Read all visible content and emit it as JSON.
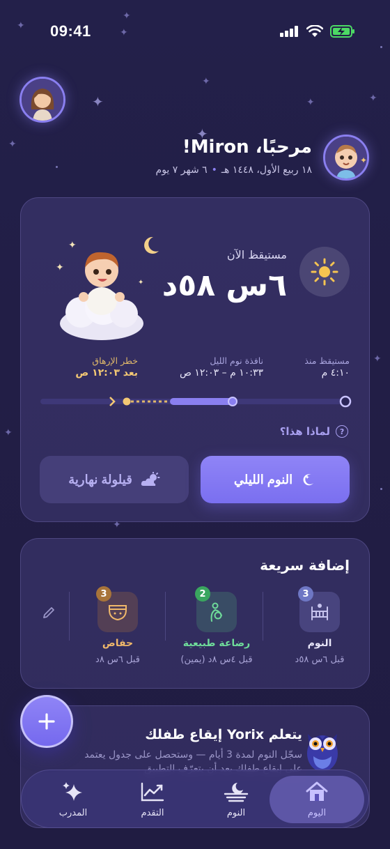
{
  "status_bar": {
    "time": "09:41"
  },
  "greeting": {
    "title": "مرحبًا، Miron!",
    "hijri_date": "١٨ ربيع الأول، ١٤٤٨ هـ",
    "baby_age": "٦ شهر ٧ يوم",
    "separator": "•"
  },
  "status_card": {
    "state_label": "مستيقظ الآن",
    "elapsed": "٦س ٥٨د",
    "awake_since": {
      "label": "مستيقظ منذ",
      "value": "٤:١٠ م"
    },
    "night_window": {
      "label": "نافذة نوم الليل",
      "value": "١٠:٣٣ م – ١٢:٠٣ ص"
    },
    "overtired_risk": {
      "label": "خطر الإرهاق",
      "value": "بعد ١٢:٠٣ ص"
    },
    "why_link": "لماذا هذا؟",
    "why_icon": "?",
    "night_sleep_button": "النوم الليلي",
    "day_nap_button": "قيلولة نهارية",
    "colors": {
      "accent": "#8a7ff0",
      "risk": "#f3c874"
    }
  },
  "quick_add": {
    "title": "إضافة سريعة",
    "items": [
      {
        "name": "النوم",
        "ago": "قبل ٦س ٥٨د",
        "count": "3",
        "icon": "crib-icon",
        "name_color": "#e8e6f8",
        "badge_color": "#6e77c4"
      },
      {
        "name": "رضاعة طبيعية",
        "ago": "قبل ٤س ٨د (يمين)",
        "count": "2",
        "icon": "breastfeeding-icon",
        "name_color": "#6fdc9a",
        "badge_color": "#3aa55f"
      },
      {
        "name": "حفاض",
        "ago": "قبل ٦س ٨د",
        "count": "3",
        "icon": "diaper-icon",
        "name_color": "#f0b86a",
        "badge_color": "#a8743a"
      }
    ]
  },
  "learning": {
    "title": "يتعلم Yorix إيقاع طفلك",
    "body": "سجّل النوم لمدة 3 أيام — وستحصل على جدول يعتمد على إيقاع طفلك بعد أن يتعرّف التطبيق"
  },
  "tab_bar": {
    "tabs": [
      {
        "label": "اليوم",
        "icon": "home-icon",
        "active": true
      },
      {
        "label": "النوم",
        "icon": "moon-sleep-icon",
        "active": false
      },
      {
        "label": "التقدم",
        "icon": "progress-chart-icon",
        "active": false
      },
      {
        "label": "المدرب",
        "icon": "sparkles-icon",
        "active": false
      }
    ]
  }
}
